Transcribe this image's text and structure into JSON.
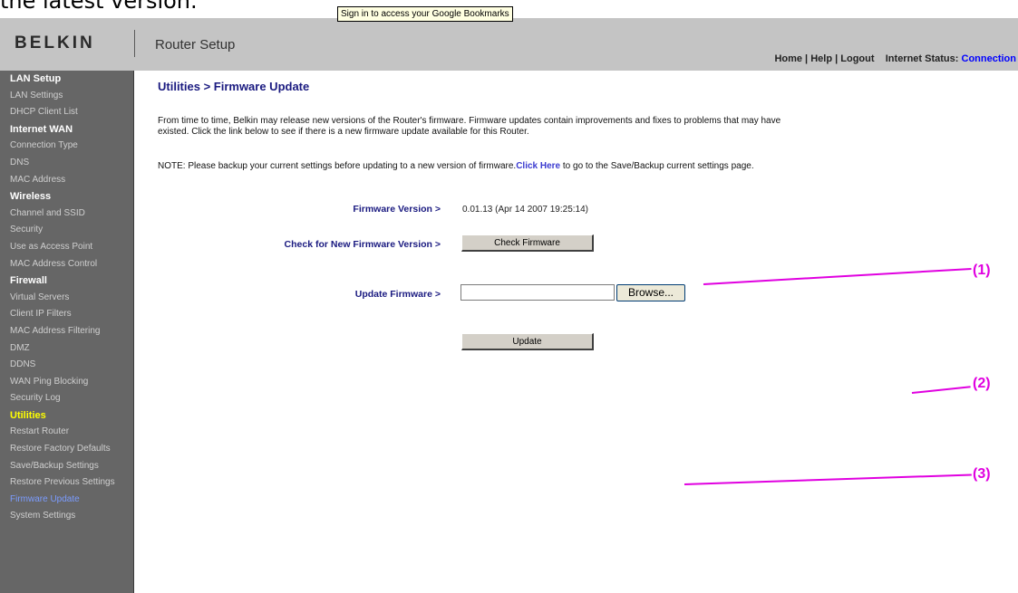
{
  "caption": "the latest version.",
  "tooltip": "Sign in to access your Google Bookmarks",
  "header": {
    "logo": "BELKIN",
    "app_title": "Router Setup",
    "links": [
      "Home",
      "Help",
      "Logout"
    ],
    "status_label": "Internet Status:",
    "status_value": "Connection"
  },
  "sidebar": {
    "items": [
      {
        "label": "LAN Setup",
        "type": "section"
      },
      {
        "label": "LAN Settings"
      },
      {
        "label": "DHCP Client List"
      },
      {
        "label": "Internet WAN",
        "type": "section"
      },
      {
        "label": "Connection Type"
      },
      {
        "label": "DNS"
      },
      {
        "label": "MAC Address"
      },
      {
        "label": "Wireless",
        "type": "section"
      },
      {
        "label": "Channel and SSID"
      },
      {
        "label": "Security"
      },
      {
        "label": "Use as Access Point"
      },
      {
        "label": "MAC Address Control"
      },
      {
        "label": "Firewall",
        "type": "section"
      },
      {
        "label": "Virtual Servers"
      },
      {
        "label": "Client IP Filters"
      },
      {
        "label": "MAC Address Filtering"
      },
      {
        "label": "DMZ"
      },
      {
        "label": "DDNS"
      },
      {
        "label": "WAN Ping Blocking"
      },
      {
        "label": "Security Log"
      },
      {
        "label": "Utilities",
        "type": "section-active"
      },
      {
        "label": "Restart Router"
      },
      {
        "label": "Restore Factory Defaults"
      },
      {
        "label": "Save/Backup Settings"
      },
      {
        "label": "Restore Previous Settings"
      },
      {
        "label": "Firmware Update",
        "type": "current"
      },
      {
        "label": "System Settings"
      }
    ]
  },
  "main": {
    "title": "Utilities > Firmware Update",
    "para1": "From time to time, Belkin may release new versions of the Router's firmware. Firmware updates contain improvements and fixes to problems that may have existed. Click the link below to see if there is a new firmware update available for this Router.",
    "para2_before": "NOTE: Please backup your current settings before updating to a new version of firmware.",
    "para2_link": "Click Here",
    "para2_after": " to go to the Save/Backup current settings page.",
    "firmware_version_label": "Firmware Version >",
    "firmware_version_value": "0.01.13 (Apr 14 2007 19:25:14)",
    "check_label": "Check for New Firmware Version >",
    "check_button": "Check Firmware",
    "update_firmware_label": "Update Firmware >",
    "file_value": "",
    "browse_button": "Browse...",
    "update_button": "Update"
  },
  "annotations": {
    "a1": "(1)",
    "a2": "(2)",
    "a3": "(3)"
  },
  "colors": {
    "annotation": "#e000e0",
    "sidebar_bg": "#666666",
    "header_bg": "#c4c4c4",
    "title": "#1a1a80",
    "active_section": "#ffff00",
    "current_item": "#7b9cff",
    "status_value": "#0000ff"
  }
}
